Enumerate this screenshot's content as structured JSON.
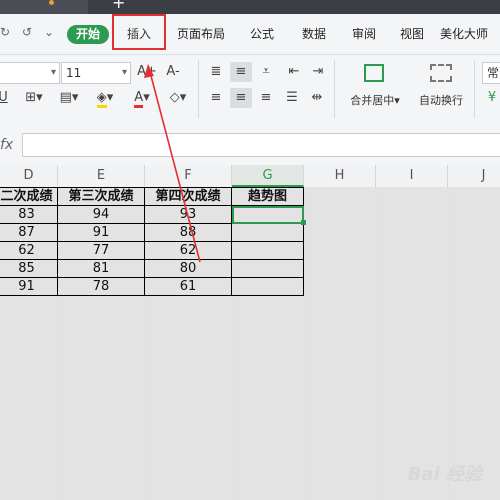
{
  "titlebar": {
    "new_tab": "+"
  },
  "menu": {
    "items": [
      "开始",
      "插入",
      "页面布局",
      "公式",
      "数据",
      "审阅",
      "视图",
      "美化大师"
    ],
    "active": "开始",
    "highlighted": "插入"
  },
  "ribbon": {
    "font_size": "11",
    "merge_label": "合并居中",
    "wrap_label": "自动换行",
    "cut_label": "常",
    "grow_font": "A+",
    "shrink_font": "A-",
    "font_color_letter": "A"
  },
  "formula_bar": {
    "fx": "fx",
    "value": ""
  },
  "columns": [
    "D",
    "E",
    "F",
    "G",
    "H",
    "I",
    "J"
  ],
  "active_column": "G",
  "table": {
    "headers": [
      "二次成绩",
      "第三次成绩",
      "第四次成绩",
      "趋势图"
    ],
    "rows": [
      [
        "83",
        "94",
        "93",
        ""
      ],
      [
        "87",
        "91",
        "88",
        ""
      ],
      [
        "62",
        "77",
        "62",
        ""
      ],
      [
        "85",
        "81",
        "80",
        ""
      ],
      [
        "91",
        "78",
        "61",
        ""
      ]
    ]
  },
  "watermark": "Bai 经验",
  "colors": {
    "accent": "#2c9a51",
    "highlight": "#e03034"
  }
}
